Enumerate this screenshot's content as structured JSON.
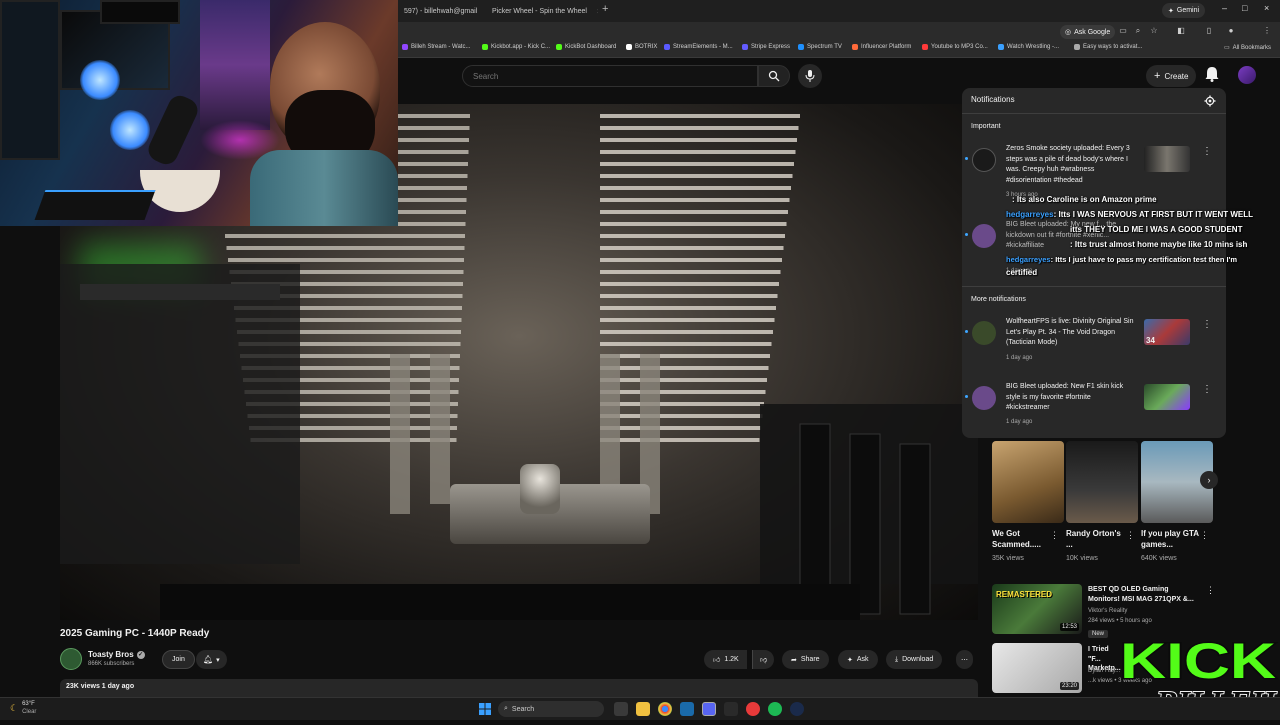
{
  "browser": {
    "tabs": [
      {
        "label": "597) - billehwah@gmail",
        "close": "×"
      },
      {
        "label": "Picker Wheel - Spin the Wheel",
        "close": "×"
      }
    ],
    "new_tab": "+",
    "gemini_label": "Gemini",
    "ask_google": "Ask Google",
    "window_controls": [
      "–",
      "□",
      "×"
    ]
  },
  "bookmarks": {
    "items": [
      {
        "label": "Billeh Stream - Watc...",
        "color": "#9146ff"
      },
      {
        "label": "Kickbot.app - Kick C...",
        "color": "#53fc18"
      },
      {
        "label": "KickBot Dashboard",
        "color": "#53fc18"
      },
      {
        "label": "BOTRIX",
        "color": "#ffffff"
      },
      {
        "label": "StreamElements - M...",
        "color": "#5a5aff"
      },
      {
        "label": "Stripe Express",
        "color": "#635bff"
      },
      {
        "label": "Spectrum TV",
        "color": "#1e90ff"
      },
      {
        "label": "Influencer Platform",
        "color": "#ff6a3a"
      },
      {
        "label": "Youtube to MP3 Co...",
        "color": "#ff3a3a"
      },
      {
        "label": "Watch Wrestling -...",
        "color": "#3aa0ff"
      },
      {
        "label": "Easy ways to activat...",
        "color": "#aaaaaa"
      }
    ],
    "all_bookmarks": "All Bookmarks"
  },
  "youtube": {
    "search_placeholder": "Search",
    "create_label": "Create"
  },
  "video": {
    "title": "2025 Gaming PC - 1440P Ready",
    "channel": "Toasty Bros",
    "subscribers": "866K subscribers",
    "join": "Join",
    "likes": "1.2K",
    "share": "Share",
    "ask": "Ask",
    "download": "Download",
    "meta": "23K views  1 day ago"
  },
  "notifications": {
    "title": "Notifications",
    "section_important": "Important",
    "section_more": "More notifications",
    "items": [
      {
        "text": "Zeros Smoke society uploaded: Every 3 steps was a pile of dead body's where I was. Creepy huh #wrabness #disorientation #thedead",
        "time": "3 hours ago",
        "avatar_color": "#1a1a1a",
        "thumb_color": "#5a5650"
      },
      {
        "text": "BIG Bleet uploaded: My new f... the kickdown out fit #fortnite #xenic... #kickaffiliate",
        "time": "1 day ago",
        "avatar_color": "#6a4a8a",
        "thumb_color": "#3a5a9a"
      },
      {
        "text": "WolfheartFPS is live: Divinity Original Sin Let's Play Pt. 34 - The Void Dragon (Tactician Mode)",
        "time": "1 day ago",
        "avatar_color": "#3a4a2a",
        "thumb_color": "#4a6a9a",
        "thumb_label": "34"
      },
      {
        "text": "BIG Bleet uploaded: New F1 skin kick style is my favorite #fortnite #kickstreamer",
        "time": "1 day ago",
        "avatar_color": "#6a4a8a",
        "thumb_color": "#6aaa5a"
      }
    ]
  },
  "chat": [
    {
      "user": "",
      "msg": ": Its also Caroline is on Amazon prime"
    },
    {
      "user": "hedgarreyes",
      "msg": ": Itts I WAS NERVOUS AT FIRST BUT IT WENT WELL"
    },
    {
      "user": "",
      "msg": "itts THEY TOLD ME I WAS A GOOD STUDENT"
    },
    {
      "user": "",
      "msg": ": Itts trust almost home maybe like 10 mins ish"
    },
    {
      "user": "hedgarreyes",
      "msg": ": Itts I just have to pass my certification test then I'm"
    },
    {
      "user": "",
      "msg": "certified"
    }
  ],
  "shorts": [
    {
      "title": "We Got Scammed.....",
      "views": "35K views",
      "color": "#8a6a3a"
    },
    {
      "title": "Randy Orton's ...",
      "views": "10K views",
      "color": "#2a2a2a"
    },
    {
      "title": "If you play GTA games...",
      "views": "640K views",
      "color": "#7a8a9a"
    }
  ],
  "recommendations": [
    {
      "title": "BEST QD OLED Gaming Monitors! MSI MAG 271QPX &...",
      "channel": "Viktor's Reality",
      "stats": "284 views • 5 hours ago",
      "duration": "12:53",
      "badge": "New",
      "thumb_text": "REMASTERED",
      "color": "#2a4a2a"
    },
    {
      "title": "I Tried \"F... Marketp...",
      "channel": "Dylan Hay...",
      "stats": "...k views • 3 weeks ago",
      "duration": "23:20",
      "color": "#d8d8d8"
    }
  ],
  "kick": {
    "logo": "KICK",
    "name": "BILLEH"
  },
  "taskbar": {
    "temp": "63°F",
    "condition": "Clear",
    "search": "Search"
  },
  "colors": {
    "yt_bg": "#0f0f0f",
    "panel": "#282828",
    "kick_green": "#53fc18",
    "chat_user": "#3aa0ff"
  }
}
